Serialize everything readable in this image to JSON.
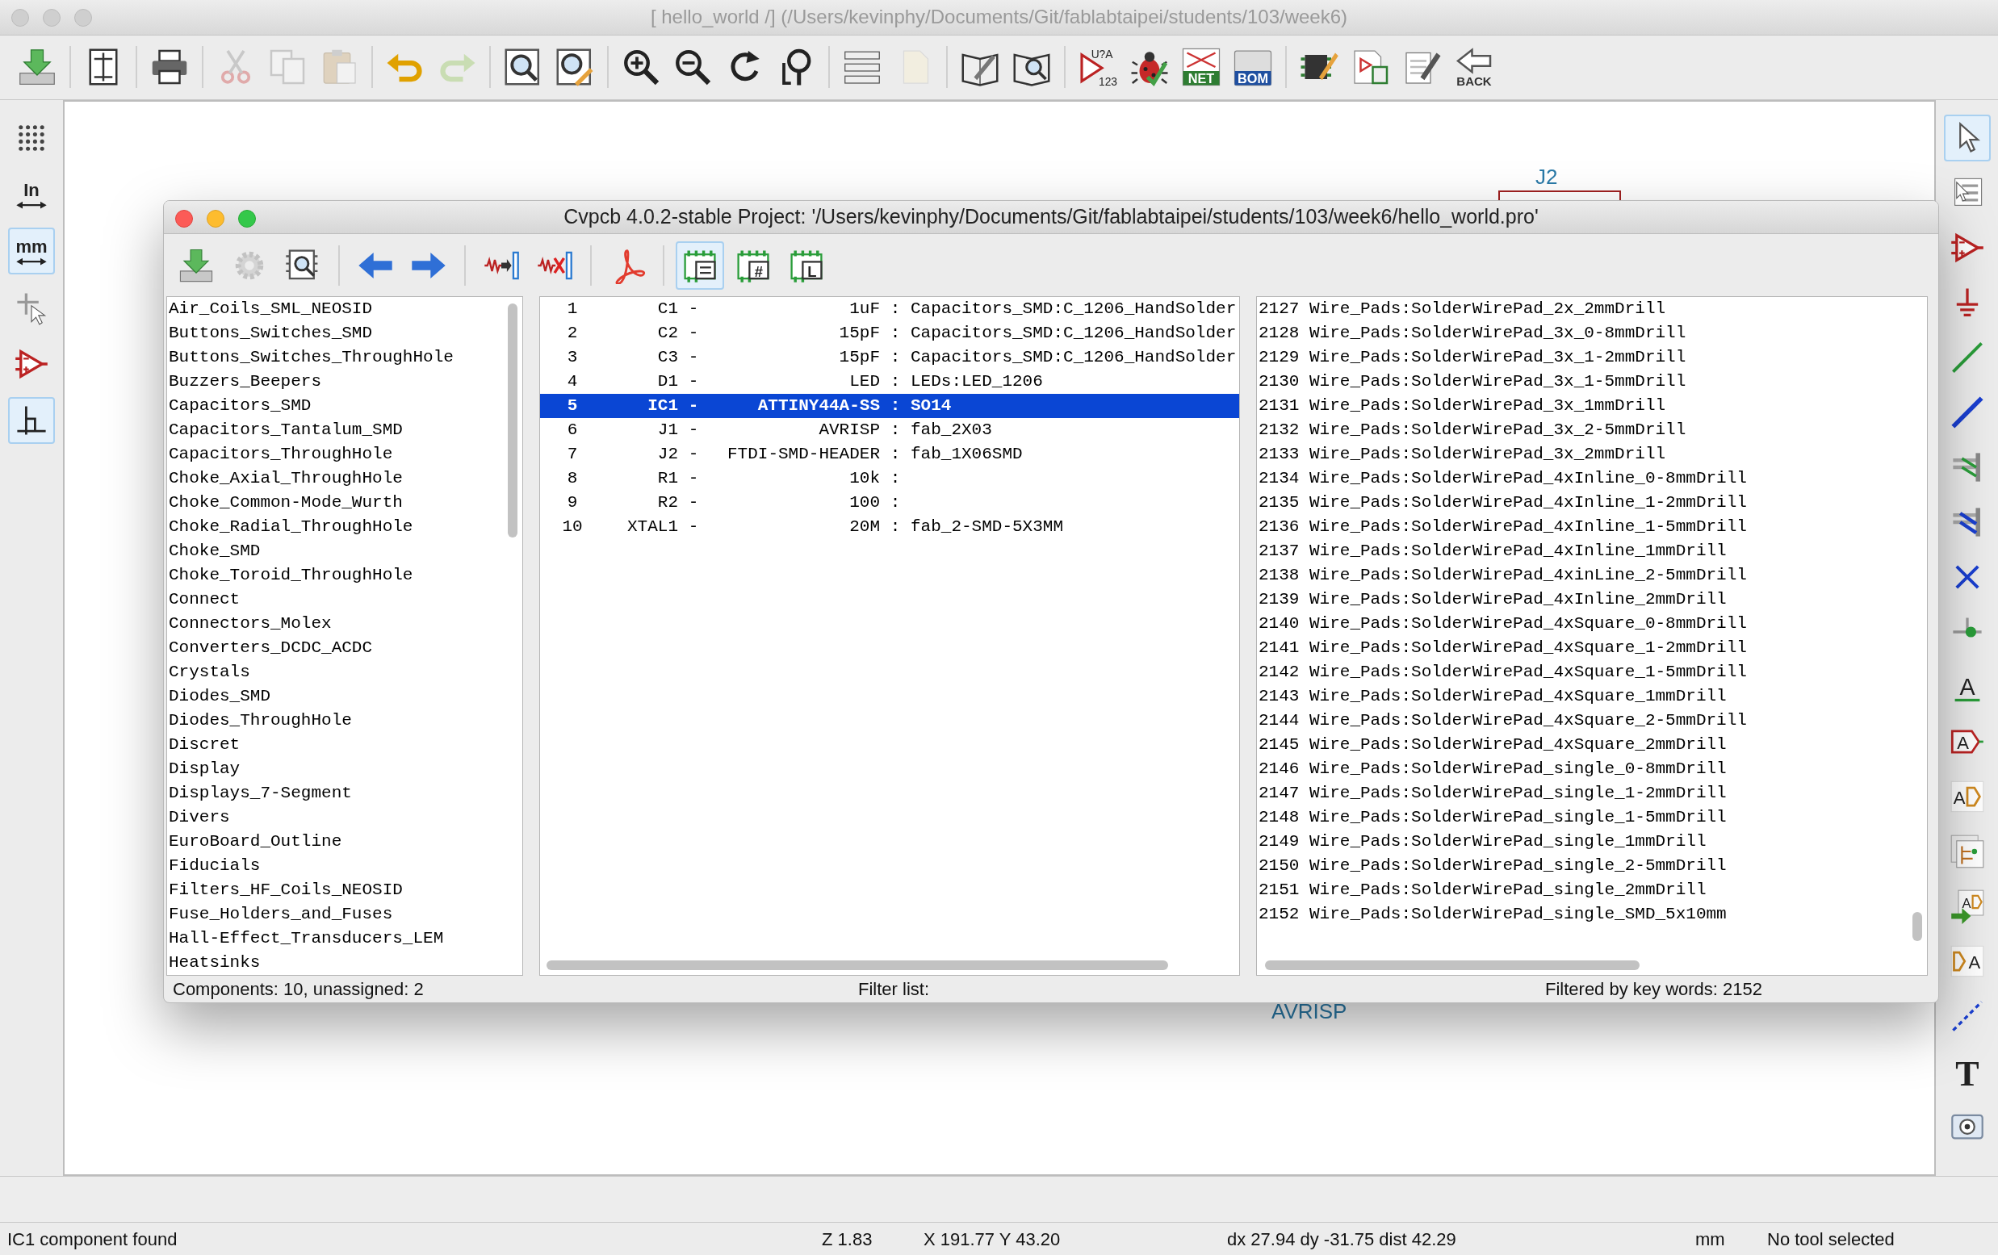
{
  "window": {
    "title": "[ hello_world /] (/Users/kevinphy/Documents/Git/fablabtaipei/students/103/week6)"
  },
  "main_toolbar": [
    [
      {
        "kind": "tray-arrow",
        "disabled": false
      }
    ],
    [
      {
        "kind": "page-layout",
        "disabled": false
      }
    ],
    [
      {
        "kind": "printer",
        "disabled": false
      }
    ],
    [
      {
        "kind": "scissors",
        "disabled": true
      },
      {
        "kind": "copy",
        "disabled": true
      },
      {
        "kind": "clipboard",
        "disabled": true
      }
    ],
    [
      {
        "kind": "undo",
        "disabled": false
      },
      {
        "kind": "redo",
        "disabled": true
      }
    ],
    [
      {
        "kind": "magnifier-page",
        "disabled": false
      },
      {
        "kind": "magnifier-pen",
        "disabled": false
      }
    ],
    [
      {
        "kind": "zoom-in",
        "disabled": false
      },
      {
        "kind": "zoom-out",
        "disabled": false
      },
      {
        "kind": "refresh",
        "disabled": false
      },
      {
        "kind": "zoom-fit",
        "disabled": false
      }
    ],
    [
      {
        "kind": "hierarchy",
        "disabled": false
      },
      {
        "kind": "page-out",
        "disabled": true
      }
    ],
    [
      {
        "kind": "book-pen",
        "disabled": false
      },
      {
        "kind": "book-magnifier",
        "disabled": false
      }
    ],
    [
      {
        "kind": "annotate",
        "disabled": false,
        "labels": [
          "U?A",
          "123"
        ]
      },
      {
        "kind": "bug",
        "disabled": false
      },
      {
        "kind": "netlist",
        "disabled": false,
        "labels": [
          "NET"
        ]
      },
      {
        "kind": "bom",
        "disabled": false,
        "labels": [
          "BOM"
        ]
      }
    ],
    [
      {
        "kind": "chip-pen",
        "disabled": false
      },
      {
        "kind": "chip-board",
        "disabled": false
      },
      {
        "kind": "notepad-pen",
        "disabled": false
      },
      {
        "kind": "back-arrow",
        "disabled": false,
        "labels": [
          "BACK"
        ]
      }
    ]
  ],
  "left_toolbar": [
    {
      "kind": "grid",
      "selected": false
    },
    {
      "kind": "inches",
      "selected": false,
      "labels": [
        "In"
      ]
    },
    {
      "kind": "millimeters",
      "selected": true,
      "labels": [
        "mm"
      ]
    },
    {
      "kind": "cursor-cross",
      "selected": false
    },
    {
      "kind": "amplifier",
      "selected": false
    },
    {
      "kind": "bus-corner",
      "selected": true
    }
  ],
  "right_toolbar": [
    {
      "kind": "arrow-pointer",
      "selected": true
    },
    {
      "kind": "page-pointer",
      "selected": false
    },
    {
      "kind": "amplifier",
      "selected": false
    },
    {
      "kind": "ground",
      "selected": false
    },
    {
      "kind": "wire",
      "selected": false
    },
    {
      "kind": "bus",
      "selected": false
    },
    {
      "kind": "wire-entry",
      "selected": false
    },
    {
      "kind": "bus-entry",
      "selected": false
    },
    {
      "kind": "cross",
      "selected": false
    },
    {
      "kind": "junction",
      "selected": false
    },
    {
      "kind": "underline-label",
      "selected": false,
      "labels": [
        "A"
      ]
    },
    {
      "kind": "tag-label",
      "selected": false,
      "labels": [
        "A"
      ]
    },
    {
      "kind": "port-label",
      "selected": false,
      "labels": [
        "A"
      ]
    },
    {
      "kind": "sheet-stack",
      "selected": false
    },
    {
      "kind": "sheet-arrow",
      "selected": false,
      "labels": [
        "A"
      ]
    },
    {
      "kind": "pin-label",
      "selected": false,
      "labels": [
        "A"
      ]
    },
    {
      "kind": "dashed-line",
      "selected": false
    },
    {
      "kind": "text-tool",
      "selected": false,
      "labels": [
        "T"
      ]
    },
    {
      "kind": "camera",
      "selected": false
    }
  ],
  "canvas": {
    "texts": [
      {
        "kind": "reference",
        "text": "J2"
      },
      {
        "kind": "value",
        "text": "AVRISP"
      }
    ]
  },
  "dialog": {
    "title": "Cvpcb 4.0.2-stable  Project: '/Users/kevinphy/Documents/Git/fablabtaipei/students/103/week6/hello_world.pro'",
    "toolbar": [
      [
        {
          "kind": "tray-arrow",
          "disabled": false,
          "selected": false
        },
        {
          "kind": "gear",
          "disabled": true,
          "selected": false
        },
        {
          "kind": "chip-magnifier",
          "disabled": false,
          "selected": false
        }
      ],
      [
        {
          "kind": "arrow-left",
          "disabled": false,
          "selected": false
        },
        {
          "kind": "arrow-right",
          "disabled": false,
          "selected": false
        }
      ],
      [
        {
          "kind": "resistor-arrow",
          "disabled": false,
          "selected": false
        },
        {
          "kind": "resistor-cross",
          "disabled": false,
          "selected": false
        }
      ],
      [
        {
          "kind": "pdf",
          "disabled": false,
          "selected": false
        }
      ],
      [
        {
          "kind": "board-list",
          "disabled": false,
          "selected": true
        },
        {
          "kind": "board-hash",
          "disabled": false,
          "selected": false,
          "labels": [
            "#"
          ]
        },
        {
          "kind": "board-letter",
          "disabled": false,
          "selected": false,
          "labels": [
            "L"
          ]
        }
      ]
    ],
    "libraries": [
      {
        "name": "Air_Coils_SML_NEOSID",
        "selected": false
      },
      {
        "name": "Buttons_Switches_SMD",
        "selected": false
      },
      {
        "name": "Buttons_Switches_ThroughHole",
        "selected": false
      },
      {
        "name": "Buzzers_Beepers",
        "selected": false
      },
      {
        "name": "Capacitors_SMD",
        "selected": false
      },
      {
        "name": "Capacitors_Tantalum_SMD",
        "selected": false
      },
      {
        "name": "Capacitors_ThroughHole",
        "selected": false
      },
      {
        "name": "Choke_Axial_ThroughHole",
        "selected": false
      },
      {
        "name": "Choke_Common-Mode_Wurth",
        "selected": false
      },
      {
        "name": "Choke_Radial_ThroughHole",
        "selected": false
      },
      {
        "name": "Choke_SMD",
        "selected": false
      },
      {
        "name": "Choke_Toroid_ThroughHole",
        "selected": false
      },
      {
        "name": "Connect",
        "selected": false
      },
      {
        "name": "Connectors_Molex",
        "selected": false
      },
      {
        "name": "Converters_DCDC_ACDC",
        "selected": false
      },
      {
        "name": "Crystals",
        "selected": false
      },
      {
        "name": "Diodes_SMD",
        "selected": false
      },
      {
        "name": "Diodes_ThroughHole",
        "selected": false
      },
      {
        "name": "Discret",
        "selected": false
      },
      {
        "name": "Display",
        "selected": false
      },
      {
        "name": "Displays_7-Segment",
        "selected": false
      },
      {
        "name": "Divers",
        "selected": false
      },
      {
        "name": "EuroBoard_Outline",
        "selected": false
      },
      {
        "name": "Fiducials",
        "selected": false
      },
      {
        "name": "Filters_HF_Coils_NEOSID",
        "selected": false
      },
      {
        "name": "Fuse_Holders_and_Fuses",
        "selected": false
      },
      {
        "name": "Hall-Effect_Transducers_LEM",
        "selected": false
      },
      {
        "name": "Heatsinks",
        "selected": false
      }
    ],
    "components": [
      {
        "number": "1",
        "reference": "C1",
        "sep_1": "-",
        "value": "1uF",
        "sep_2": ":",
        "footprint": "Capacitors_SMD:C_1206_HandSolder",
        "selected": false
      },
      {
        "number": "2",
        "reference": "C2",
        "sep_1": "-",
        "value": "15pF",
        "sep_2": ":",
        "footprint": "Capacitors_SMD:C_1206_HandSolder",
        "selected": false
      },
      {
        "number": "3",
        "reference": "C3",
        "sep_1": "-",
        "value": "15pF",
        "sep_2": ":",
        "footprint": "Capacitors_SMD:C_1206_HandSolder",
        "selected": false
      },
      {
        "number": "4",
        "reference": "D1",
        "sep_1": "-",
        "value": "LED",
        "sep_2": ":",
        "footprint": "LEDs:LED_1206",
        "selected": false
      },
      {
        "number": "5",
        "reference": "IC1",
        "sep_1": "-",
        "value": "ATTINY44A-SS",
        "sep_2": ":",
        "footprint": "SO14",
        "selected": true
      },
      {
        "number": "6",
        "reference": "J1",
        "sep_1": "-",
        "value": "AVRISP",
        "sep_2": ":",
        "footprint": "fab_2X03",
        "selected": false
      },
      {
        "number": "7",
        "reference": "J2",
        "sep_1": "-",
        "value": "FTDI-SMD-HEADER",
        "sep_2": ":",
        "footprint": "fab_1X06SMD",
        "selected": false
      },
      {
        "number": "8",
        "reference": "R1",
        "sep_1": "-",
        "value": "10k",
        "sep_2": ":",
        "selected": false
      },
      {
        "number": "9",
        "reference": "R2",
        "sep_1": "-",
        "value": "100",
        "sep_2": ":",
        "selected": false
      },
      {
        "number": "10",
        "reference": "XTAL1",
        "sep_1": "-",
        "value": "20M",
        "sep_2": ":",
        "footprint": "fab_2-SMD-5X3MM",
        "selected": false
      }
    ],
    "footprints": [
      {
        "name": "2127 Wire_Pads:SolderWirePad_2x_2mmDrill",
        "selected": false
      },
      {
        "name": "2128 Wire_Pads:SolderWirePad_3x_0-8mmDrill",
        "selected": false
      },
      {
        "name": "2129 Wire_Pads:SolderWirePad_3x_1-2mmDrill",
        "selected": false
      },
      {
        "name": "2130 Wire_Pads:SolderWirePad_3x_1-5mmDrill",
        "selected": false
      },
      {
        "name": "2131 Wire_Pads:SolderWirePad_3x_1mmDrill",
        "selected": false
      },
      {
        "name": "2132 Wire_Pads:SolderWirePad_3x_2-5mmDrill",
        "selected": false
      },
      {
        "name": "2133 Wire_Pads:SolderWirePad_3x_2mmDrill",
        "selected": false
      },
      {
        "name": "2134 Wire_Pads:SolderWirePad_4xInline_0-8mmDrill",
        "selected": false
      },
      {
        "name": "2135 Wire_Pads:SolderWirePad_4xInline_1-2mmDrill",
        "selected": false
      },
      {
        "name": "2136 Wire_Pads:SolderWirePad_4xInline_1-5mmDrill",
        "selected": false
      },
      {
        "name": "2137 Wire_Pads:SolderWirePad_4xInline_1mmDrill",
        "selected": false
      },
      {
        "name": "2138 Wire_Pads:SolderWirePad_4xinLine_2-5mmDrill",
        "selected": false
      },
      {
        "name": "2139 Wire_Pads:SolderWirePad_4xInline_2mmDrill",
        "selected": false
      },
      {
        "name": "2140 Wire_Pads:SolderWirePad_4xSquare_0-8mmDrill",
        "selected": false
      },
      {
        "name": "2141 Wire_Pads:SolderWirePad_4xSquare_1-2mmDrill",
        "selected": false
      },
      {
        "name": "2142 Wire_Pads:SolderWirePad_4xSquare_1-5mmDrill",
        "selected": false
      },
      {
        "name": "2143 Wire_Pads:SolderWirePad_4xSquare_1mmDrill",
        "selected": false
      },
      {
        "name": "2144 Wire_Pads:SolderWirePad_4xSquare_2-5mmDrill",
        "selected": false
      },
      {
        "name": "2145 Wire_Pads:SolderWirePad_4xSquare_2mmDrill",
        "selected": false
      },
      {
        "name": "2146 Wire_Pads:SolderWirePad_single_0-8mmDrill",
        "selected": false
      },
      {
        "name": "2147 Wire_Pads:SolderWirePad_single_1-2mmDrill",
        "selected": false
      },
      {
        "name": "2148 Wire_Pads:SolderWirePad_single_1-5mmDrill",
        "selected": false
      },
      {
        "name": "2149 Wire_Pads:SolderWirePad_single_1mmDrill",
        "selected": false
      },
      {
        "name": "2150 Wire_Pads:SolderWirePad_single_2-5mmDrill",
        "selected": false
      },
      {
        "name": "2151 Wire_Pads:SolderWirePad_single_2mmDrill",
        "selected": false
      },
      {
        "name": "2152 Wire_Pads:SolderWirePad_single_SMD_5x10mm",
        "selected": false
      }
    ],
    "status_bar": [
      "Components: 10, unassigned: 2",
      "Filter list:",
      "Filtered by key words: 2152"
    ]
  },
  "status_bar": [
    "IC1 component found",
    "Z 1.83",
    "X 191.77  Y 43.20",
    "dx 27.94  dy -31.75  dist 42.29",
    "mm",
    "No tool selected"
  ]
}
